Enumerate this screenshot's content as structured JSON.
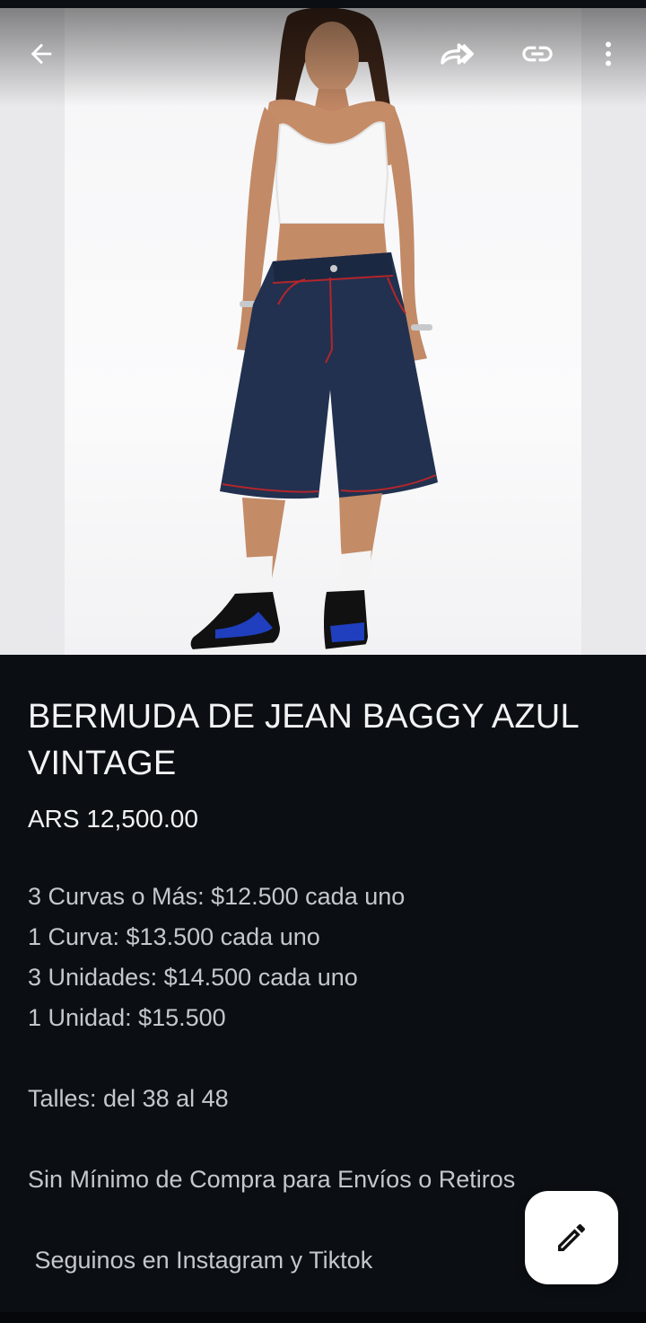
{
  "product": {
    "title": "BERMUDA DE JEAN BAGGY AZUL VINTAGE",
    "price": "ARS 12,500.00",
    "description": [
      "3 Curvas o Más: $12.500 cada uno",
      "1 Curva: $13.500 cada uno",
      "3 Unidades: $14.500 cada uno",
      "1 Unidad: $15.500",
      "",
      "Talles: del 38 al 48",
      "",
      "Sin Mínimo de Compra para Envíos o Retiros",
      "",
      " Seguinos en Instagram y Tiktok"
    ]
  },
  "icons": {
    "back": "arrow-left-icon",
    "share": "share-forward-icon",
    "link": "link-icon",
    "more": "more-vertical-icon",
    "edit": "pencil-icon"
  },
  "colors": {
    "background": "#0b0f13",
    "text_primary": "#f1f3f4",
    "text_secondary": "#c4c7cc",
    "fab_background": "#ffffff",
    "denim": "#22314f",
    "stitching": "#b3262c"
  }
}
